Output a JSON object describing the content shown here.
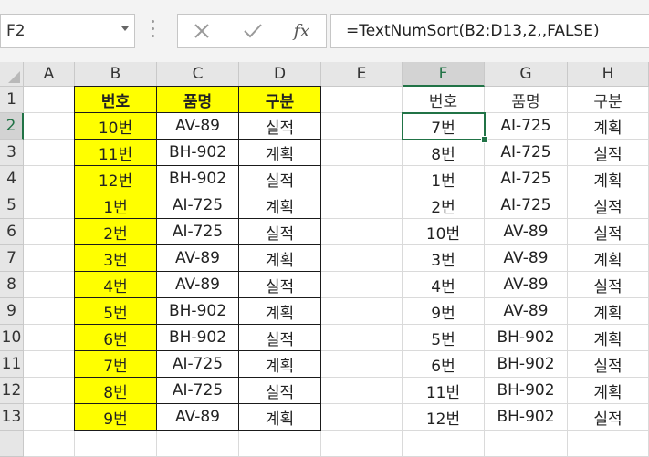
{
  "name_box": {
    "value": "F2"
  },
  "formula_bar": {
    "cancel_icon": "close-icon",
    "enter_icon": "check-icon",
    "function_label": "fx",
    "formula": "=TextNumSort(B2:D13,2,,FALSE)"
  },
  "columns": [
    "A",
    "B",
    "C",
    "D",
    "E",
    "F",
    "G",
    "H"
  ],
  "rows": [
    "1",
    "2",
    "3",
    "4",
    "5",
    "6",
    "7",
    "8",
    "9",
    "10",
    "11",
    "12",
    "13"
  ],
  "source_table": {
    "headers": [
      "번호",
      "품명",
      "구분"
    ],
    "rows": [
      [
        "10번",
        "AV-89",
        "실적"
      ],
      [
        "11번",
        "BH-902",
        "계획"
      ],
      [
        "12번",
        "BH-902",
        "실적"
      ],
      [
        "1번",
        "AI-725",
        "계획"
      ],
      [
        "2번",
        "AI-725",
        "실적"
      ],
      [
        "3번",
        "AV-89",
        "계획"
      ],
      [
        "4번",
        "AV-89",
        "실적"
      ],
      [
        "5번",
        "BH-902",
        "계획"
      ],
      [
        "6번",
        "BH-902",
        "실적"
      ],
      [
        "7번",
        "AI-725",
        "계획"
      ],
      [
        "8번",
        "AI-725",
        "실적"
      ],
      [
        "9번",
        "AV-89",
        "계획"
      ]
    ],
    "header_fill": "#ffff00",
    "id_fill": "#ffff00"
  },
  "result_table": {
    "headers": [
      "번호",
      "품명",
      "구분"
    ],
    "rows": [
      [
        "7번",
        "AI-725",
        "계획"
      ],
      [
        "8번",
        "AI-725",
        "실적"
      ],
      [
        "1번",
        "AI-725",
        "계획"
      ],
      [
        "2번",
        "AI-725",
        "실적"
      ],
      [
        "10번",
        "AV-89",
        "실적"
      ],
      [
        "3번",
        "AV-89",
        "계획"
      ],
      [
        "4번",
        "AV-89",
        "실적"
      ],
      [
        "9번",
        "AV-89",
        "계획"
      ],
      [
        "5번",
        "BH-902",
        "계획"
      ],
      [
        "6번",
        "BH-902",
        "실적"
      ],
      [
        "11번",
        "BH-902",
        "계획"
      ],
      [
        "12번",
        "BH-902",
        "실적"
      ]
    ]
  },
  "active_cell": "F2",
  "accent_color": "#217346"
}
